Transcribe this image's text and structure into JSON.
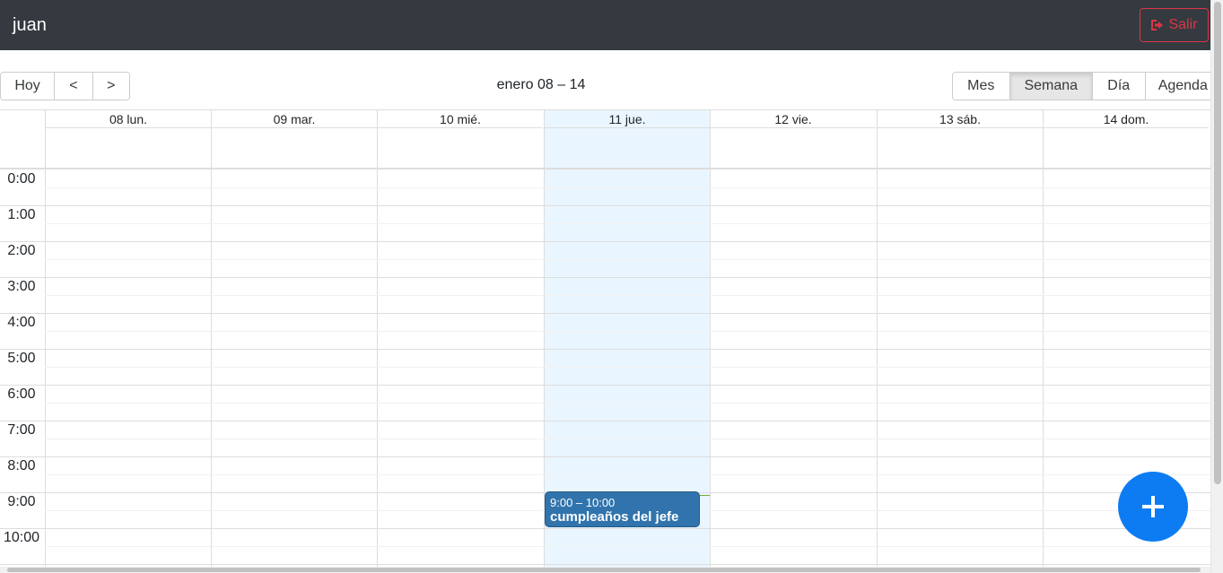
{
  "navbar": {
    "user_name": "juan",
    "logout_label": "Salir"
  },
  "toolbar": {
    "nav": {
      "today": "Hoy",
      "prev": "<",
      "next": ">"
    },
    "range_label": "enero 08 – 14",
    "views": [
      "Mes",
      "Semana",
      "Día",
      "Agenda"
    ],
    "active_view": "Semana"
  },
  "week": {
    "days": [
      "08 lun.",
      "09 mar.",
      "10 mié.",
      "11 jue.",
      "12 vie.",
      "13 sáb.",
      "14 dom."
    ],
    "today_label": "11 jue.",
    "hours": [
      "0:00",
      "1:00",
      "2:00",
      "3:00",
      "4:00",
      "5:00",
      "6:00",
      "7:00",
      "8:00",
      "9:00",
      "10:00"
    ]
  },
  "event": {
    "time": "9:00 – 10:00",
    "title": "cumpleaños del jefe"
  },
  "colors": {
    "navbar": "#343a40",
    "event": "#3174ad",
    "today": "#eaf6ff",
    "fab": "#0d7cf2",
    "danger": "#dc3545"
  },
  "icons": {
    "logout": "sign-out-icon",
    "add": "plus-icon"
  }
}
